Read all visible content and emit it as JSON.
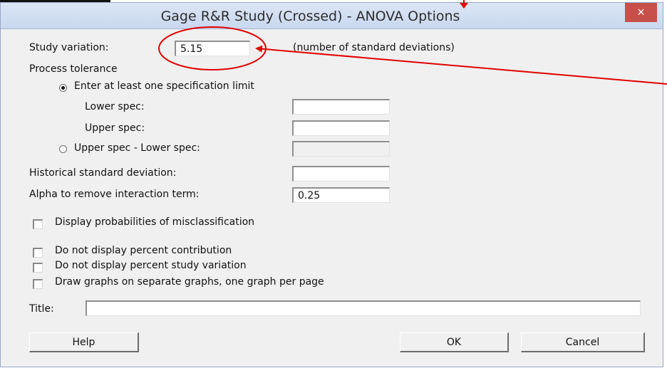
{
  "window": {
    "title": "Gage R&R Study (Crossed) - ANOVA Options",
    "close_symbol": "×"
  },
  "study_variation": {
    "label": "Study variation:",
    "value": "5.15",
    "note": "(number of standard deviations)"
  },
  "process_tolerance": {
    "label": "Process tolerance",
    "option_spec_limit": "Enter at least one specification limit",
    "lower_spec_label": "Lower spec:",
    "lower_spec_value": "",
    "upper_spec_label": "Upper spec:",
    "upper_spec_value": "",
    "option_range": "Upper spec - Lower spec:",
    "range_value": ""
  },
  "historical_std": {
    "label": "Historical standard deviation:",
    "value": ""
  },
  "alpha": {
    "label": "Alpha to remove interaction term:",
    "value": "0.25"
  },
  "checkboxes": {
    "misclassification": "Display probabilities of misclassification",
    "no_percent_contribution": "Do not display percent contribution",
    "no_percent_study_variation": "Do not display percent study variation",
    "separate_graphs": "Draw graphs on separate graphs, one graph per page"
  },
  "title_field": {
    "label": "Title:",
    "value": ""
  },
  "buttons": {
    "help": "Help",
    "ok": "OK",
    "cancel": "Cancel"
  },
  "colors": {
    "annotation": "#e00000",
    "close_button": "#c7504b"
  }
}
